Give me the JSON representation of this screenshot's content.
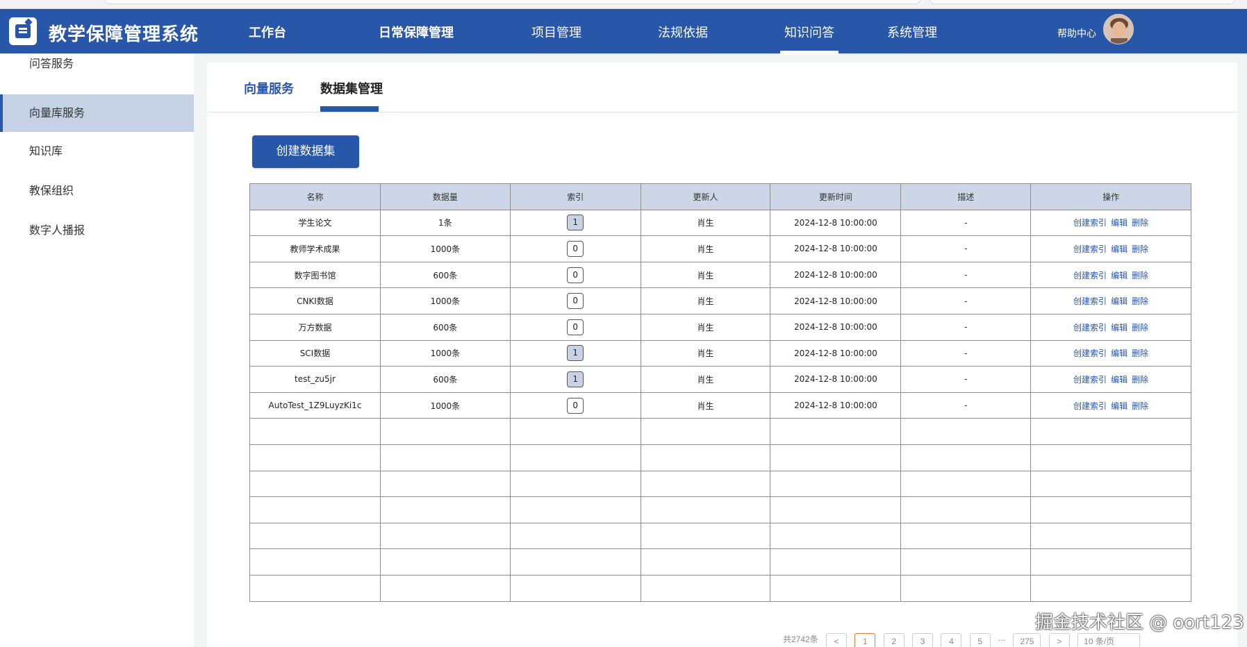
{
  "header": {
    "app_title": "教学保障管理系统",
    "nav": [
      {
        "label": "工作台"
      },
      {
        "label": "日常保障管理"
      },
      {
        "label": "项目管理"
      },
      {
        "label": "法规依据"
      },
      {
        "label": "知识问答"
      },
      {
        "label": "系统管理"
      }
    ],
    "help": "帮助中心",
    "brand_color": "#2856a9"
  },
  "sidebar": {
    "items": [
      {
        "label": "问答服务"
      },
      {
        "label": "向量库服务"
      },
      {
        "label": "知识库"
      },
      {
        "label": "教保组织"
      },
      {
        "label": "数字人播报"
      }
    ]
  },
  "tabs": [
    {
      "label": "向量服务"
    },
    {
      "label": "数据集管理"
    }
  ],
  "create_button": "创建数据集",
  "table": {
    "headers": [
      "名称",
      "数据量",
      "索引",
      "更新人",
      "更新时间",
      "描述",
      "操作"
    ],
    "rows": [
      {
        "name": "学生论文",
        "count": "1条",
        "index": "1",
        "updater": "肖生",
        "time": "2024-12-8 10:00:00",
        "desc": "-"
      },
      {
        "name": "教师学术成果",
        "count": "1000条",
        "index": "0",
        "updater": "肖生",
        "time": "2024-12-8 10:00:00",
        "desc": "-"
      },
      {
        "name": "数字图书馆",
        "count": "600条",
        "index": "0",
        "updater": "肖生",
        "time": "2024-12-8 10:00:00",
        "desc": "-"
      },
      {
        "name": "CNKI数据",
        "count": "1000条",
        "index": "0",
        "updater": "肖生",
        "time": "2024-12-8 10:00:00",
        "desc": "-"
      },
      {
        "name": "万方数据",
        "count": "600条",
        "index": "0",
        "updater": "肖生",
        "time": "2024-12-8 10:00:00",
        "desc": "-"
      },
      {
        "name": "SCI数据",
        "count": "1000条",
        "index": "1",
        "updater": "肖生",
        "time": "2024-12-8 10:00:00",
        "desc": "-"
      },
      {
        "name": "test_zu5jr",
        "count": "600条",
        "index": "1",
        "updater": "肖生",
        "time": "2024-12-8 10:00:00",
        "desc": "-"
      },
      {
        "name": "AutoTest_1Z9LuyzKi1c",
        "count": "1000条",
        "index": "0",
        "updater": "肖生",
        "time": "2024-12-8 10:00:00",
        "desc": "-"
      }
    ],
    "actions": [
      "创建索引",
      "编辑",
      "删除"
    ]
  },
  "pager": {
    "total": "共2742条",
    "prev": "<",
    "pages": [
      "1",
      "2",
      "3",
      "4",
      "5"
    ],
    "ellipsis": "...",
    "last": "275",
    "next": ">",
    "page_size": "10 条/页"
  },
  "watermark": "掘金技术社区 @ oort123"
}
